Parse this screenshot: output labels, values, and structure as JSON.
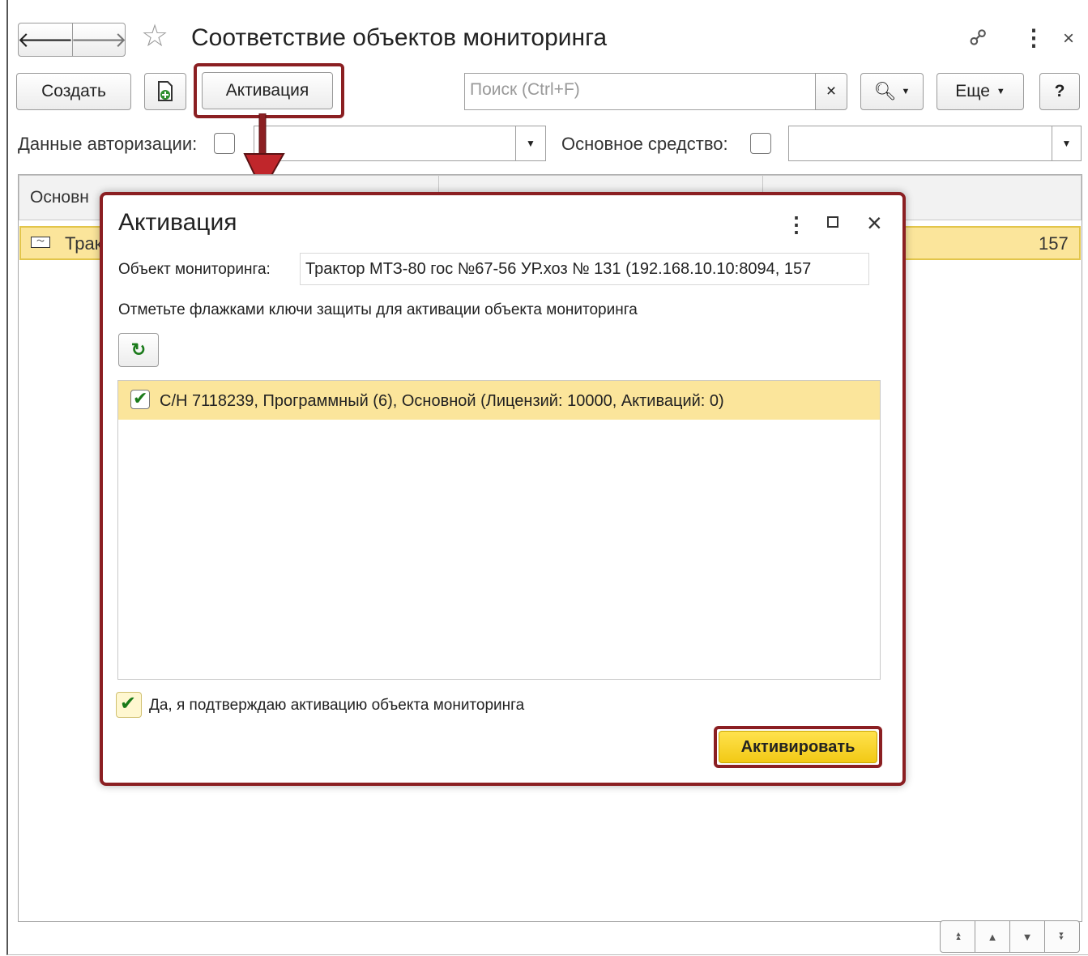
{
  "window": {
    "title": "Соответствие объектов мониторинга"
  },
  "toolbar": {
    "create_label": "Создать",
    "activate_label": "Активация",
    "search_placeholder": "Поиск (Ctrl+F)",
    "search_clear": "×",
    "more_label": "Еще",
    "help_label": "?"
  },
  "filters": {
    "auth_label": "Данные авторизации:",
    "asset_label": "Основное средство:"
  },
  "grid": {
    "col1_header": "Основн",
    "row": {
      "cell1": "Трак",
      "cell_end": "157"
    }
  },
  "dialog": {
    "title": "Активация",
    "object_label": "Объект мониторинга:",
    "object_value": "Трактор  МТЗ-80 гос №67-56 УР.хоз № 131 (192.168.10.10:8094, 157",
    "instruction": "Отметьте флажками ключи защиты для активации объекта мониторинга",
    "keys": [
      {
        "label": "С/Н 7118239, Программный (6), Основной (Лицензий: 10000, Активаций: 0)",
        "checked": true
      }
    ],
    "confirm_label": "Да, я подтверждаю активацию объекта мониторинга",
    "confirm_checked": true,
    "activate_button": "Активировать"
  },
  "colors": {
    "highlight": "#8b1f22",
    "selected_row": "#fbe59b",
    "primary_button": "#f5d52a"
  }
}
